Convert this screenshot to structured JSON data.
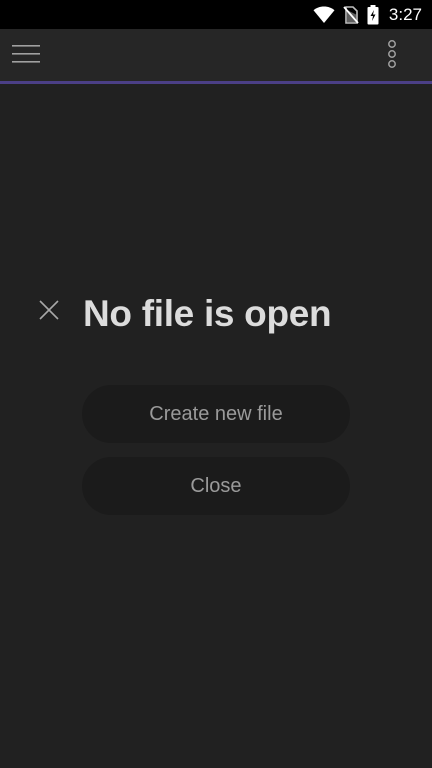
{
  "status_bar": {
    "time": "3:27",
    "icons": [
      "wifi-icon",
      "no-sim-icon",
      "battery-charging-icon"
    ]
  },
  "app_bar": {
    "menu_icon": "hamburger-menu-icon",
    "more_icon": "more-vertical-icon",
    "accent_color": "#4b3f86"
  },
  "empty_state": {
    "dismiss_icon": "close-icon",
    "title": "No file is open",
    "actions": {
      "create": "Create new file",
      "close": "Close"
    }
  },
  "colors": {
    "background": "#212121",
    "app_bar": "#262626",
    "button_background": "#1b1b1b",
    "title_text": "#dcdcdc",
    "button_text": "#9a9a9a"
  }
}
